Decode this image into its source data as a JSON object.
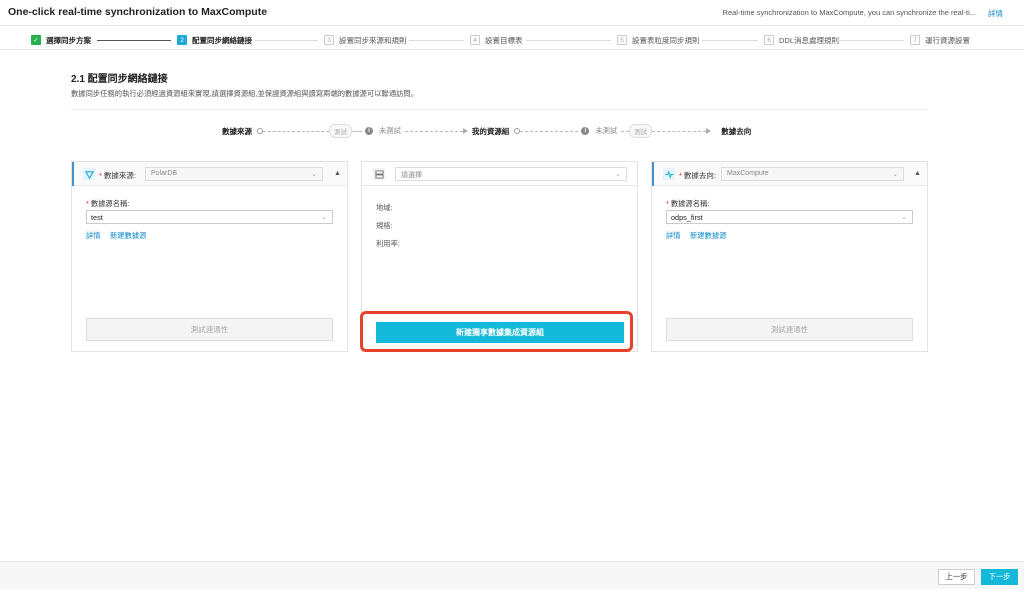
{
  "header": {
    "title": "One-click real-time synchronization to MaxCompute",
    "notice": "Real-time synchronization to MaxCompute, you can synchronize the real-ti...",
    "notice_link": "詳情"
  },
  "steps": [
    {
      "num": "✓",
      "label": "選擇同步方案",
      "state": "done"
    },
    {
      "num": "2",
      "label": "配置同步網絡鏈接",
      "state": "active"
    },
    {
      "num": "3",
      "label": "設置同步來源和規則",
      "state": "pending"
    },
    {
      "num": "4",
      "label": "設置目標表",
      "state": "pending"
    },
    {
      "num": "5",
      "label": "設置表粒度同步規則",
      "state": "pending"
    },
    {
      "num": "6",
      "label": "DDL消息處理規則",
      "state": "pending"
    },
    {
      "num": "7",
      "label": "運行資源設置",
      "state": "pending"
    }
  ],
  "section": {
    "title": "2.1 配置同步網絡鏈接",
    "desc": "數據同步任務的執行必須經過資源組來實現,請選擇資源組,並保證資源組與讀寫兩端的數據源可以聯通訪問。"
  },
  "flow": {
    "source": "數據來源",
    "test_pill_1": "測試",
    "untested_1": "未測試",
    "resource_group": "我的資源組",
    "untested_2": "未測試",
    "test_pill_2": "測試",
    "target": "數據去向",
    "info_glyph": "i"
  },
  "source_card": {
    "required": "*",
    "label": "數據來源:",
    "type_value": "PolarDB",
    "name_label": "數據源名稱:",
    "name_value": "test",
    "detail_link": "詳情",
    "new_link": "新建數據源",
    "test_button": "測試連通性",
    "collapse": "▲"
  },
  "resource_card": {
    "placeholder": "請選擇",
    "region_label": "地域:",
    "spec_label": "規格:",
    "usage_label": "利用率:",
    "create_button": "新建獨享數據集成資源組"
  },
  "target_card": {
    "required": "*",
    "label": "數據去向:",
    "type_value": "MaxCompute",
    "name_label": "數據源名稱:",
    "name_value": "odps_first",
    "detail_link": "詳情",
    "new_link": "新建數據源",
    "test_button": "測試連通性",
    "collapse": "▲"
  },
  "footer": {
    "prev": "上一步",
    "next": "下一步"
  },
  "colors": {
    "accent": "#14b8d8",
    "done": "#27b14c",
    "highlight": "#e8402b",
    "link": "#0d87c8"
  }
}
